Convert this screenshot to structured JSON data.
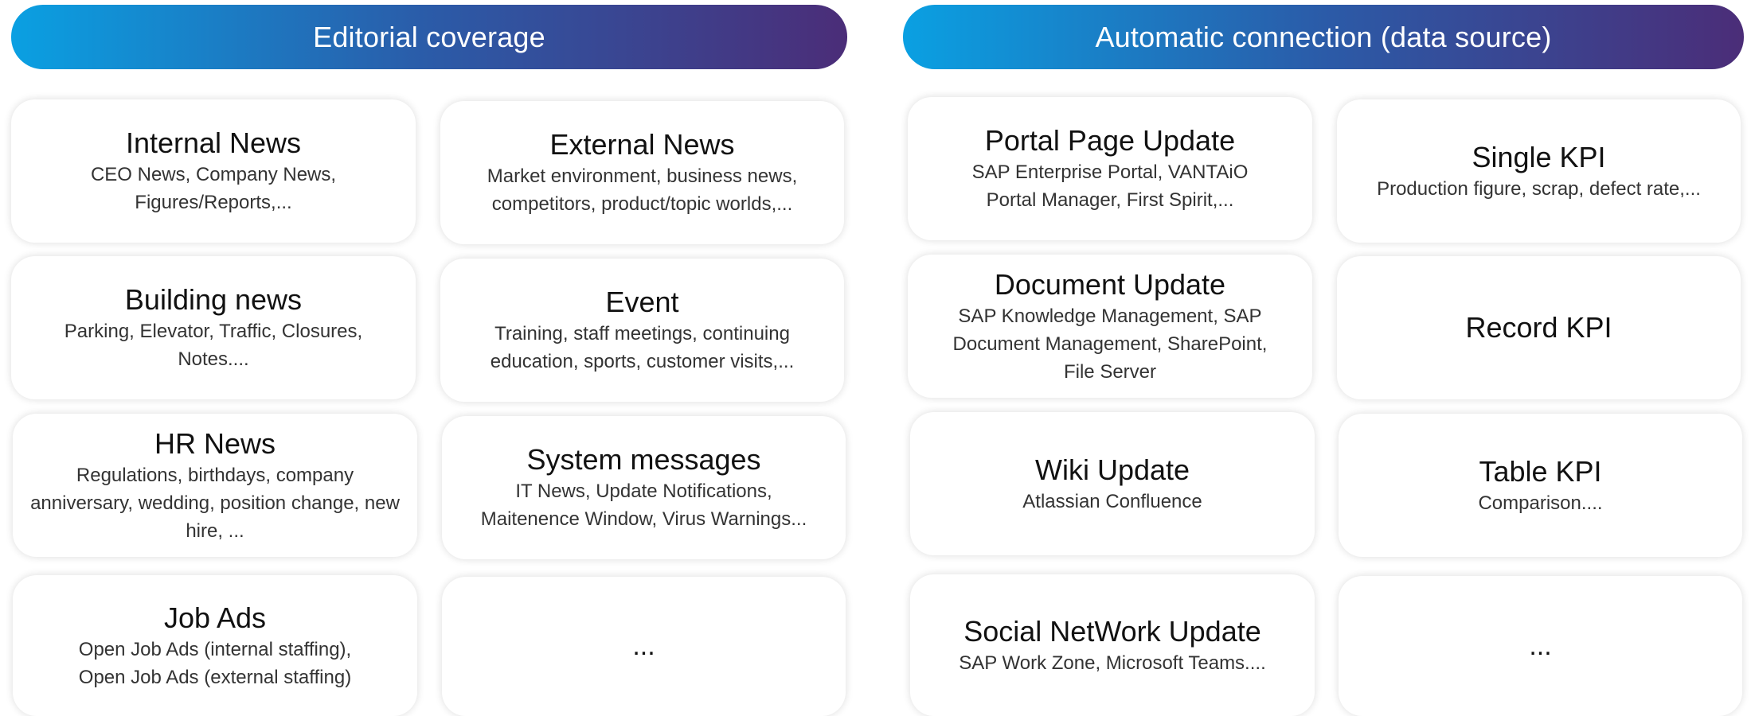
{
  "left": {
    "header": "Editorial coverage",
    "cards": [
      {
        "title": "Internal News",
        "desc": "CEO News, Company News, Figures/Reports,..."
      },
      {
        "title": "External News",
        "desc": "Market environment, business news, competitors, product/topic worlds,..."
      },
      {
        "title": "Building news",
        "desc": "Parking, Elevator, Traffic, Closures, Notes...."
      },
      {
        "title": "Event",
        "desc": "Training, staff meetings, continuing education, sports, customer visits,..."
      },
      {
        "title": "HR News",
        "desc": "Regulations, birthdays, company anniversary, wedding, position change, new hire, ..."
      },
      {
        "title": "System messages",
        "desc": "IT News, Update Notifications, Maitenence Window, Virus Warnings..."
      },
      {
        "title": "Job Ads",
        "desc": "Open Job Ads (internal staffing), Open Job Ads (external staffing)"
      },
      {
        "title": "...",
        "desc": ""
      }
    ]
  },
  "right": {
    "header": "Automatic connection (data source)",
    "cards": [
      {
        "title": "Portal Page Update",
        "desc": "SAP Enterprise Portal, VANTAiO Portal Manager, First Spirit,..."
      },
      {
        "title": "Single KPI",
        "desc": "Production figure, scrap, defect rate,..."
      },
      {
        "title": "Document Update",
        "desc": "SAP Knowledge Management, SAP Document Management, SharePoint, File Server"
      },
      {
        "title": "Record KPI",
        "desc": ""
      },
      {
        "title": "Wiki Update",
        "desc": "Atlassian Confluence"
      },
      {
        "title": "Table KPI",
        "desc": "Comparison...."
      },
      {
        "title": "Social NetWork Update",
        "desc": "SAP Work Zone, Microsoft Teams...."
      },
      {
        "title": "...",
        "desc": ""
      }
    ]
  }
}
